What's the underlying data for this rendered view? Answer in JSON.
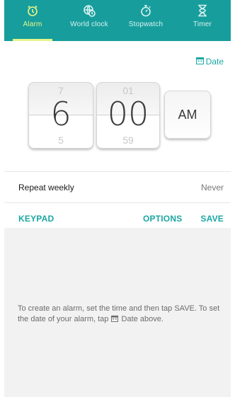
{
  "tabs": [
    {
      "label": "Alarm",
      "icon": "alarm-clock-icon",
      "active": true
    },
    {
      "label": "World clock",
      "icon": "globe-clock-icon",
      "active": false
    },
    {
      "label": "Stopwatch",
      "icon": "stopwatch-icon",
      "active": false
    },
    {
      "label": "Timer",
      "icon": "hourglass-icon",
      "active": false
    }
  ],
  "date_link": {
    "label": "Date",
    "icon": "calendar-icon"
  },
  "picker": {
    "hour": {
      "prev": "7",
      "value": "6",
      "next": "5"
    },
    "minute": {
      "prev": "01",
      "value": "00",
      "next": "59"
    },
    "ampm": "AM"
  },
  "repeat": {
    "label": "Repeat weekly",
    "value": "Never"
  },
  "actions": {
    "keypad": "KEYPAD",
    "options": "OPTIONS",
    "save": "SAVE"
  },
  "hint": {
    "part1": "To create an alarm, set the time and then tap SAVE. To set the date of your alarm, tap",
    "part2": "Date above."
  },
  "colors": {
    "accent": "#179e9c",
    "active_tab": "#e8f58a",
    "link": "#1aa7a3"
  }
}
